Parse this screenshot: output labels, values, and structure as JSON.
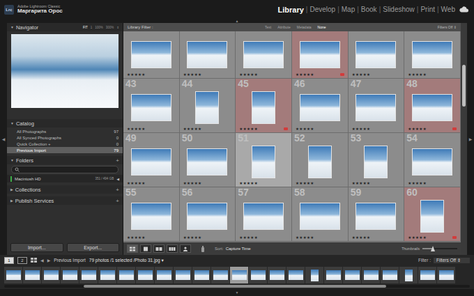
{
  "app": {
    "logo": "Lrc",
    "product": "Adobe Lightroom Classic",
    "user": "Маргарита Орос"
  },
  "modules": [
    {
      "label": "Library",
      "selected": true
    },
    {
      "label": "Develop",
      "selected": false
    },
    {
      "label": "Map",
      "selected": false
    },
    {
      "label": "Book",
      "selected": false
    },
    {
      "label": "Slideshow",
      "selected": false
    },
    {
      "label": "Print",
      "selected": false
    },
    {
      "label": "Web",
      "selected": false
    }
  ],
  "module_separator": "|",
  "panel_arrows": {
    "top": "▲",
    "bottom": "▼",
    "left": "◀",
    "right": "▶"
  },
  "navigator": {
    "title": "Navigator",
    "toggle": "▼",
    "zoom": [
      {
        "label": "FIT",
        "selected": true
      },
      {
        "label": "1",
        "selected": false
      },
      {
        "label": "100%",
        "selected": false
      },
      {
        "label": "300%",
        "selected": false
      }
    ],
    "zoom_menu": "⇕"
  },
  "catalog": {
    "title": "Catalog",
    "toggle": "▼",
    "expanded": true,
    "items": [
      {
        "label": "All Photographs",
        "count": "97",
        "selected": false
      },
      {
        "label": "All Synced Photographs",
        "count": "0",
        "selected": false
      },
      {
        "label": "Quick Collection +",
        "count": "0",
        "selected": false
      },
      {
        "label": "Previous Import",
        "count": "79",
        "selected": true
      }
    ]
  },
  "folders": {
    "title": "Folders",
    "toggle": "▼",
    "expanded": true,
    "add": "+",
    "volume": {
      "name": "Macintosh HD",
      "space": "351 / 494 GB",
      "arrow": "◀",
      "color": "#3fae49"
    }
  },
  "collections": {
    "title": "Collections",
    "toggle": "▶",
    "expanded": false,
    "add": "+"
  },
  "publish": {
    "title": "Publish Services",
    "toggle": "▶",
    "expanded": false,
    "add": "+"
  },
  "panel_buttons": [
    "Import...",
    "Export..."
  ],
  "filter_bar": {
    "title": "Library Filter :",
    "options": [
      {
        "label": "Text",
        "selected": false
      },
      {
        "label": "Attribute",
        "selected": false
      },
      {
        "label": "Metadata",
        "selected": false
      },
      {
        "label": "None",
        "selected": true
      }
    ],
    "preset": "Filters Off",
    "preset_menu": "⇕"
  },
  "grid": {
    "star": "★",
    "rows": [
      {
        "partial": true,
        "cells": [
          {
            "index": "",
            "kind": "landscape",
            "stars": 5,
            "labeled": false,
            "selected": false,
            "color": "#8c8c8c"
          },
          {
            "index": "",
            "kind": "landscape",
            "stars": 5,
            "labeled": false,
            "selected": false,
            "color": "#8c8c8c"
          },
          {
            "index": "",
            "kind": "landscape",
            "stars": 5,
            "labeled": false,
            "selected": false,
            "color": "#8c8c8c"
          },
          {
            "index": "",
            "kind": "landscape",
            "stars": 5,
            "labeled": true,
            "selected": false,
            "color": "#a37b7b"
          },
          {
            "index": "",
            "kind": "landscape",
            "stars": 5,
            "labeled": false,
            "selected": false,
            "color": "#8c8c8c"
          },
          {
            "index": "",
            "kind": "landscape",
            "stars": 5,
            "labeled": false,
            "selected": false,
            "color": "#8c8c8c"
          }
        ]
      },
      {
        "partial": false,
        "cells": [
          {
            "index": "43",
            "kind": "landscape",
            "stars": 5,
            "labeled": false,
            "selected": false,
            "color": "#8c8c8c"
          },
          {
            "index": "44",
            "kind": "portrait",
            "stars": 5,
            "labeled": false,
            "selected": false,
            "color": "#8c8c8c"
          },
          {
            "index": "45",
            "kind": "portrait",
            "stars": 5,
            "labeled": true,
            "selected": false,
            "color": "#a37b7b"
          },
          {
            "index": "46",
            "kind": "landscape",
            "stars": 5,
            "labeled": false,
            "selected": false,
            "color": "#8c8c8c"
          },
          {
            "index": "47",
            "kind": "landscape",
            "stars": 5,
            "labeled": false,
            "selected": false,
            "color": "#8c8c8c"
          },
          {
            "index": "48",
            "kind": "landscape",
            "stars": 5,
            "labeled": true,
            "selected": false,
            "color": "#a37b7b"
          }
        ]
      },
      {
        "partial": false,
        "cells": [
          {
            "index": "49",
            "kind": "landscape",
            "stars": 5,
            "labeled": false,
            "selected": false,
            "color": "#8c8c8c"
          },
          {
            "index": "50",
            "kind": "landscape",
            "stars": 5,
            "labeled": false,
            "selected": false,
            "color": "#8c8c8c"
          },
          {
            "index": "51",
            "kind": "portrait",
            "stars": 5,
            "labeled": false,
            "selected": true,
            "color": "#8c8c8c"
          },
          {
            "index": "52",
            "kind": "portrait",
            "stars": 5,
            "labeled": false,
            "selected": false,
            "color": "#8c8c8c"
          },
          {
            "index": "53",
            "kind": "portrait",
            "stars": 5,
            "labeled": false,
            "selected": false,
            "color": "#8c8c8c"
          },
          {
            "index": "54",
            "kind": "landscape",
            "stars": 5,
            "labeled": false,
            "selected": false,
            "color": "#8c8c8c"
          }
        ]
      },
      {
        "partial": false,
        "cells": [
          {
            "index": "55",
            "kind": "landscape",
            "stars": 5,
            "labeled": false,
            "selected": false,
            "color": "#8c8c8c"
          },
          {
            "index": "56",
            "kind": "landscape",
            "stars": 5,
            "labeled": false,
            "selected": false,
            "color": "#8c8c8c"
          },
          {
            "index": "57",
            "kind": "landscape",
            "stars": 5,
            "labeled": false,
            "selected": false,
            "color": "#8c8c8c"
          },
          {
            "index": "58",
            "kind": "landscape",
            "stars": 5,
            "labeled": false,
            "selected": false,
            "color": "#8c8c8c"
          },
          {
            "index": "59",
            "kind": "landscape",
            "stars": 5,
            "labeled": false,
            "selected": false,
            "color": "#8c8c8c"
          },
          {
            "index": "60",
            "kind": "portrait",
            "stars": 5,
            "labeled": true,
            "selected": false,
            "color": "#a37b7b"
          }
        ]
      }
    ]
  },
  "toolbar": {
    "views": [
      {
        "kind": "grid",
        "selected": true
      },
      {
        "kind": "loupe",
        "selected": false
      },
      {
        "kind": "compare",
        "selected": false
      },
      {
        "kind": "survey",
        "selected": false
      },
      {
        "kind": "people",
        "selected": false
      }
    ],
    "sort_label": "Sort:",
    "sort_value": "Capture Time",
    "thumb_label": "Thumbnails",
    "thumb_level": 0.3
  },
  "filmstrip_header": {
    "monitors": [
      {
        "label": "1",
        "selected": true
      },
      {
        "label": "2",
        "selected": false
      }
    ],
    "back": "◀",
    "forward": "▶",
    "source": "Previous Import",
    "info": "79 photos /1 selected /Photo 31.jpg",
    "info_menu": "▾",
    "filter_label": "Filter :",
    "filter_value": "Filters Off",
    "filter_menu": "⇕"
  },
  "filmstrip": [
    {
      "kind": "landscape",
      "selected": false
    },
    {
      "kind": "landscape",
      "selected": false
    },
    {
      "kind": "landscape",
      "selected": false
    },
    {
      "kind": "landscape",
      "selected": false
    },
    {
      "kind": "landscape",
      "selected": false
    },
    {
      "kind": "landscape",
      "selected": false
    },
    {
      "kind": "landscape",
      "selected": false
    },
    {
      "kind": "landscape",
      "selected": false
    },
    {
      "kind": "landscape",
      "selected": false
    },
    {
      "kind": "landscape",
      "selected": false
    },
    {
      "kind": "landscape",
      "selected": false
    },
    {
      "kind": "landscape",
      "selected": false
    },
    {
      "kind": "landscape",
      "selected": true
    },
    {
      "kind": "landscape",
      "selected": false
    },
    {
      "kind": "landscape",
      "selected": false
    },
    {
      "kind": "landscape",
      "selected": false
    },
    {
      "kind": "portrait",
      "selected": false
    },
    {
      "kind": "landscape",
      "selected": false
    },
    {
      "kind": "landscape",
      "selected": false
    },
    {
      "kind": "landscape",
      "selected": false
    },
    {
      "kind": "landscape",
      "selected": false
    },
    {
      "kind": "portrait",
      "selected": false
    },
    {
      "kind": "landscape",
      "selected": false
    },
    {
      "kind": "landscape",
      "selected": false
    }
  ]
}
